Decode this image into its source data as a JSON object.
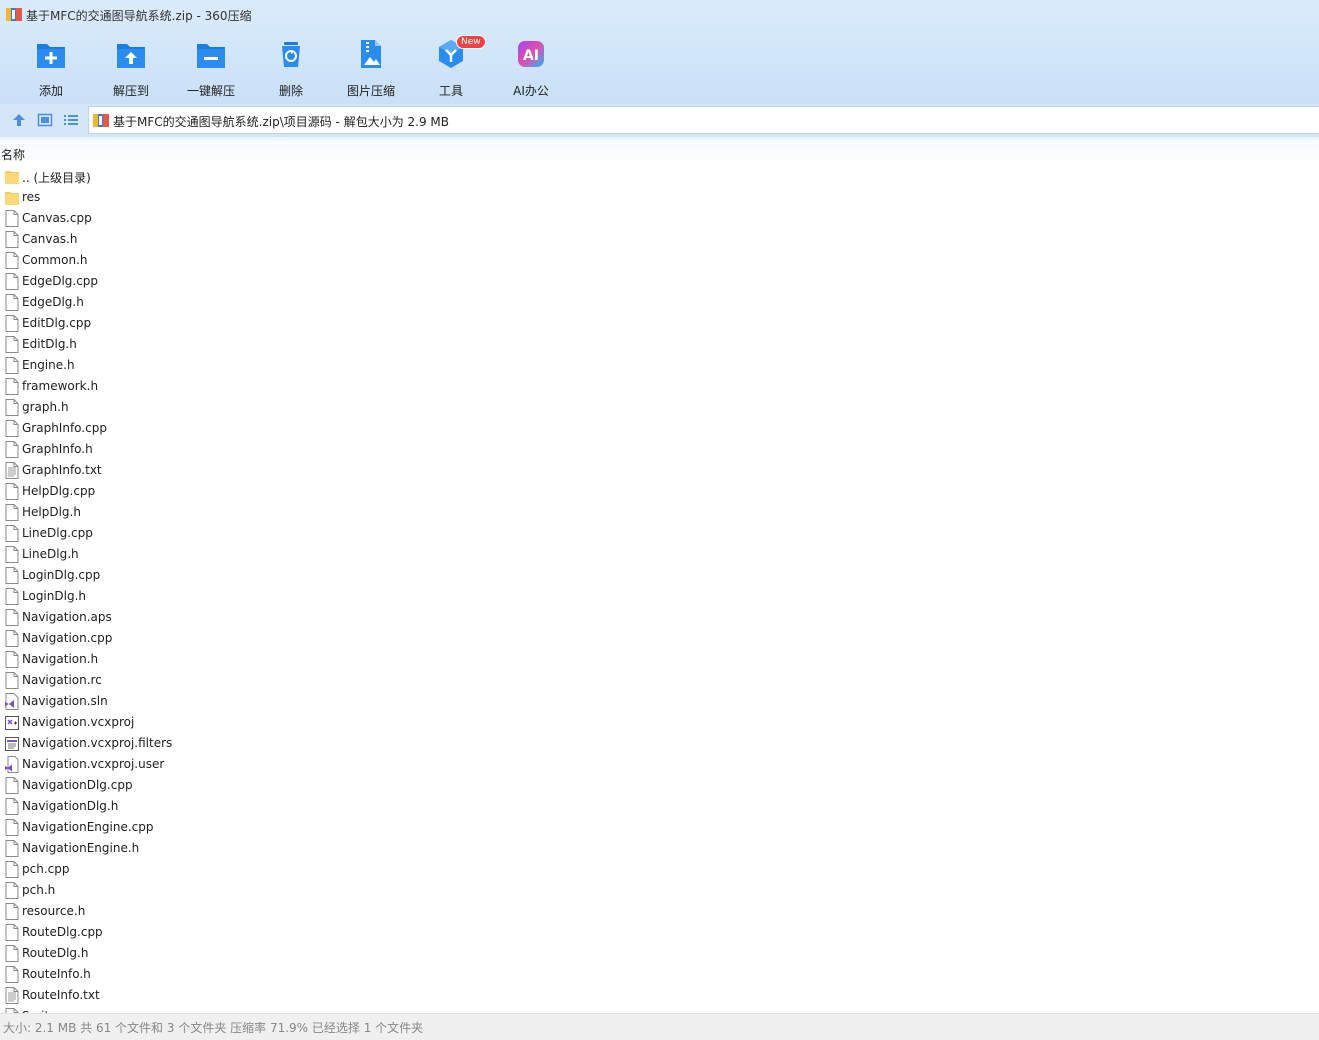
{
  "window": {
    "title": "基于MFC的交通图导航系统.zip - 360压缩"
  },
  "toolbar": {
    "items": [
      {
        "label": "添加",
        "icon": "add-icon"
      },
      {
        "label": "解压到",
        "icon": "extract-to-icon"
      },
      {
        "label": "一键解压",
        "icon": "one-click-extract-icon"
      },
      {
        "label": "删除",
        "icon": "recycle-delete-icon"
      },
      {
        "label": "图片压缩",
        "icon": "image-compress-icon"
      },
      {
        "label": "工具",
        "icon": "tools-icon",
        "badge": "New"
      },
      {
        "label": "AI办公",
        "icon": "ai-office-icon"
      }
    ]
  },
  "address": {
    "path": "基于MFC的交通图导航系统.zip\\项目源码 - 解包大小为 2.9 MB"
  },
  "columns": {
    "name": "名称"
  },
  "files": [
    {
      "name": ".. (上级目录)",
      "type": "folder"
    },
    {
      "name": "res",
      "type": "folder"
    },
    {
      "name": "Canvas.cpp",
      "type": "file"
    },
    {
      "name": "Canvas.h",
      "type": "file"
    },
    {
      "name": "Common.h",
      "type": "file"
    },
    {
      "name": "EdgeDlg.cpp",
      "type": "file"
    },
    {
      "name": "EdgeDlg.h",
      "type": "file"
    },
    {
      "name": "EditDlg.cpp",
      "type": "file"
    },
    {
      "name": "EditDlg.h",
      "type": "file"
    },
    {
      "name": "Engine.h",
      "type": "file"
    },
    {
      "name": "framework.h",
      "type": "file"
    },
    {
      "name": "graph.h",
      "type": "file"
    },
    {
      "name": "GraphInfo.cpp",
      "type": "file"
    },
    {
      "name": "GraphInfo.h",
      "type": "file"
    },
    {
      "name": "GraphInfo.txt",
      "type": "text"
    },
    {
      "name": "HelpDlg.cpp",
      "type": "file"
    },
    {
      "name": "HelpDlg.h",
      "type": "file"
    },
    {
      "name": "LineDlg.cpp",
      "type": "file"
    },
    {
      "name": "LineDlg.h",
      "type": "file"
    },
    {
      "name": "LoginDlg.cpp",
      "type": "file"
    },
    {
      "name": "LoginDlg.h",
      "type": "file"
    },
    {
      "name": "Navigation.aps",
      "type": "file"
    },
    {
      "name": "Navigation.cpp",
      "type": "file"
    },
    {
      "name": "Navigation.h",
      "type": "file"
    },
    {
      "name": "Navigation.rc",
      "type": "file"
    },
    {
      "name": "Navigation.sln",
      "type": "sln"
    },
    {
      "name": "Navigation.vcxproj",
      "type": "vcxproj"
    },
    {
      "name": "Navigation.vcxproj.filters",
      "type": "filters"
    },
    {
      "name": "Navigation.vcxproj.user",
      "type": "user"
    },
    {
      "name": "NavigationDlg.cpp",
      "type": "file"
    },
    {
      "name": "NavigationDlg.h",
      "type": "file"
    },
    {
      "name": "NavigationEngine.cpp",
      "type": "file"
    },
    {
      "name": "NavigationEngine.h",
      "type": "file"
    },
    {
      "name": "pch.cpp",
      "type": "file"
    },
    {
      "name": "pch.h",
      "type": "file"
    },
    {
      "name": "resource.h",
      "type": "file"
    },
    {
      "name": "RouteDlg.cpp",
      "type": "file"
    },
    {
      "name": "RouteDlg.h",
      "type": "file"
    },
    {
      "name": "RouteInfo.h",
      "type": "file"
    },
    {
      "name": "RouteInfo.txt",
      "type": "text"
    },
    {
      "name": "Scrit",
      "type": "file"
    }
  ],
  "status": {
    "text": "大小: 2.1 MB 共 61 个文件和 3 个文件夹 压缩率 71.9% 已经选择 1 个文件夹"
  }
}
